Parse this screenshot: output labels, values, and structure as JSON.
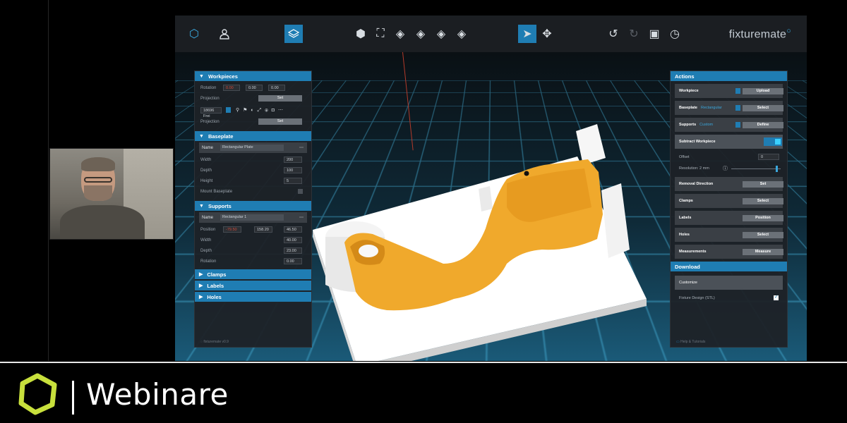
{
  "toolbar": {
    "brand": "fixturemate",
    "buttons": [
      "hexagon-icon",
      "user-icon",
      "layers-icon",
      "cube-solid-icon",
      "frame-icon",
      "cube-front-icon",
      "cube-side-icon",
      "cube-iso-icon",
      "cube-top-icon",
      "cursor-icon",
      "move-icon",
      "undo-icon",
      "redo-icon",
      "save-icon",
      "history-icon"
    ]
  },
  "left_panel": {
    "workpieces": {
      "title": "Workpieces",
      "rotation_label": "Rotation",
      "rotation_values": [
        "0.00",
        "0.00",
        "0.00"
      ],
      "projection_label": "Projection",
      "set_label": "Set",
      "file_name": "18696 Frei"
    },
    "baseplate": {
      "title": "Baseplate",
      "name_label": "Name",
      "name_value": "Rectangular Plate",
      "width_label": "Width",
      "width_value": "200",
      "depth_label": "Depth",
      "depth_value": "100",
      "height_label": "Height",
      "height_value": "5",
      "mount_label": "Mount Baseplate"
    },
    "supports": {
      "title": "Supports",
      "name_label": "Name",
      "name_value": "Rectangular 1",
      "position_label": "Position",
      "position_values": [
        "-79.50",
        "158.20",
        "46.50"
      ],
      "width_label": "Width",
      "width_value": "40.00",
      "depth_label": "Depth",
      "depth_value": "23.00",
      "rotation_label": "Rotation",
      "rotation_value": "0.00"
    },
    "collapsed": [
      "Clamps",
      "Labels",
      "Holes"
    ],
    "footer": "fixturemate v0.9"
  },
  "right_panel": {
    "actions_title": "Actions",
    "workpiece_label": "Workpiece",
    "upload_label": "Upload",
    "baseplate_label": "Baseplate",
    "baseplate_type": "Rectangular",
    "select_label": "Select",
    "supports_label": "Supports",
    "supports_type": "Custom",
    "define_label": "Define",
    "subtract_label": "Subtract Workpiece",
    "offset_label": "Offset",
    "offset_value": "0",
    "resolution_label": "Resolution: 2 mm",
    "resolution_level": 0.92,
    "removal_label": "Removal Direction",
    "set_label": "Set",
    "clamps_label": "Clamps",
    "clamps_btn": "Select",
    "labels_label": "Labels",
    "labels_btn": "Position",
    "holes_label": "Holes",
    "holes_btn": "Select",
    "measurements_label": "Measurements",
    "measurements_btn": "Measure",
    "download_title": "Download",
    "customize_label": "Customize",
    "fixture_design_label": "Fixture Design (STL)",
    "footer": "Help & Tutorials"
  },
  "banner": {
    "title": "Webinare",
    "logo_color": "#c8e03c"
  },
  "colors": {
    "accent": "#1f7db3",
    "part": "#f0a92c",
    "fixture": "#ffffff"
  }
}
